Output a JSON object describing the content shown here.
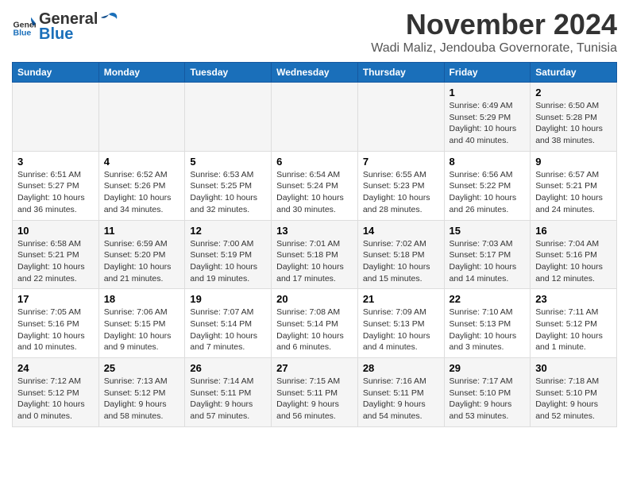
{
  "logo": {
    "general": "General",
    "blue": "Blue"
  },
  "title": "November 2024",
  "subtitle": "Wadi Maliz, Jendouba Governorate, Tunisia",
  "weekdays": [
    "Sunday",
    "Monday",
    "Tuesday",
    "Wednesday",
    "Thursday",
    "Friday",
    "Saturday"
  ],
  "rows": [
    [
      {
        "day": "",
        "info": ""
      },
      {
        "day": "",
        "info": ""
      },
      {
        "day": "",
        "info": ""
      },
      {
        "day": "",
        "info": ""
      },
      {
        "day": "",
        "info": ""
      },
      {
        "day": "1",
        "info": "Sunrise: 6:49 AM\nSunset: 5:29 PM\nDaylight: 10 hours\nand 40 minutes."
      },
      {
        "day": "2",
        "info": "Sunrise: 6:50 AM\nSunset: 5:28 PM\nDaylight: 10 hours\nand 38 minutes."
      }
    ],
    [
      {
        "day": "3",
        "info": "Sunrise: 6:51 AM\nSunset: 5:27 PM\nDaylight: 10 hours\nand 36 minutes."
      },
      {
        "day": "4",
        "info": "Sunrise: 6:52 AM\nSunset: 5:26 PM\nDaylight: 10 hours\nand 34 minutes."
      },
      {
        "day": "5",
        "info": "Sunrise: 6:53 AM\nSunset: 5:25 PM\nDaylight: 10 hours\nand 32 minutes."
      },
      {
        "day": "6",
        "info": "Sunrise: 6:54 AM\nSunset: 5:24 PM\nDaylight: 10 hours\nand 30 minutes."
      },
      {
        "day": "7",
        "info": "Sunrise: 6:55 AM\nSunset: 5:23 PM\nDaylight: 10 hours\nand 28 minutes."
      },
      {
        "day": "8",
        "info": "Sunrise: 6:56 AM\nSunset: 5:22 PM\nDaylight: 10 hours\nand 26 minutes."
      },
      {
        "day": "9",
        "info": "Sunrise: 6:57 AM\nSunset: 5:21 PM\nDaylight: 10 hours\nand 24 minutes."
      }
    ],
    [
      {
        "day": "10",
        "info": "Sunrise: 6:58 AM\nSunset: 5:21 PM\nDaylight: 10 hours\nand 22 minutes."
      },
      {
        "day": "11",
        "info": "Sunrise: 6:59 AM\nSunset: 5:20 PM\nDaylight: 10 hours\nand 21 minutes."
      },
      {
        "day": "12",
        "info": "Sunrise: 7:00 AM\nSunset: 5:19 PM\nDaylight: 10 hours\nand 19 minutes."
      },
      {
        "day": "13",
        "info": "Sunrise: 7:01 AM\nSunset: 5:18 PM\nDaylight: 10 hours\nand 17 minutes."
      },
      {
        "day": "14",
        "info": "Sunrise: 7:02 AM\nSunset: 5:18 PM\nDaylight: 10 hours\nand 15 minutes."
      },
      {
        "day": "15",
        "info": "Sunrise: 7:03 AM\nSunset: 5:17 PM\nDaylight: 10 hours\nand 14 minutes."
      },
      {
        "day": "16",
        "info": "Sunrise: 7:04 AM\nSunset: 5:16 PM\nDaylight: 10 hours\nand 12 minutes."
      }
    ],
    [
      {
        "day": "17",
        "info": "Sunrise: 7:05 AM\nSunset: 5:16 PM\nDaylight: 10 hours\nand 10 minutes."
      },
      {
        "day": "18",
        "info": "Sunrise: 7:06 AM\nSunset: 5:15 PM\nDaylight: 10 hours\nand 9 minutes."
      },
      {
        "day": "19",
        "info": "Sunrise: 7:07 AM\nSunset: 5:14 PM\nDaylight: 10 hours\nand 7 minutes."
      },
      {
        "day": "20",
        "info": "Sunrise: 7:08 AM\nSunset: 5:14 PM\nDaylight: 10 hours\nand 6 minutes."
      },
      {
        "day": "21",
        "info": "Sunrise: 7:09 AM\nSunset: 5:13 PM\nDaylight: 10 hours\nand 4 minutes."
      },
      {
        "day": "22",
        "info": "Sunrise: 7:10 AM\nSunset: 5:13 PM\nDaylight: 10 hours\nand 3 minutes."
      },
      {
        "day": "23",
        "info": "Sunrise: 7:11 AM\nSunset: 5:12 PM\nDaylight: 10 hours\nand 1 minute."
      }
    ],
    [
      {
        "day": "24",
        "info": "Sunrise: 7:12 AM\nSunset: 5:12 PM\nDaylight: 10 hours\nand 0 minutes."
      },
      {
        "day": "25",
        "info": "Sunrise: 7:13 AM\nSunset: 5:12 PM\nDaylight: 9 hours\nand 58 minutes."
      },
      {
        "day": "26",
        "info": "Sunrise: 7:14 AM\nSunset: 5:11 PM\nDaylight: 9 hours\nand 57 minutes."
      },
      {
        "day": "27",
        "info": "Sunrise: 7:15 AM\nSunset: 5:11 PM\nDaylight: 9 hours\nand 56 minutes."
      },
      {
        "day": "28",
        "info": "Sunrise: 7:16 AM\nSunset: 5:11 PM\nDaylight: 9 hours\nand 54 minutes."
      },
      {
        "day": "29",
        "info": "Sunrise: 7:17 AM\nSunset: 5:10 PM\nDaylight: 9 hours\nand 53 minutes."
      },
      {
        "day": "30",
        "info": "Sunrise: 7:18 AM\nSunset: 5:10 PM\nDaylight: 9 hours\nand 52 minutes."
      }
    ]
  ]
}
